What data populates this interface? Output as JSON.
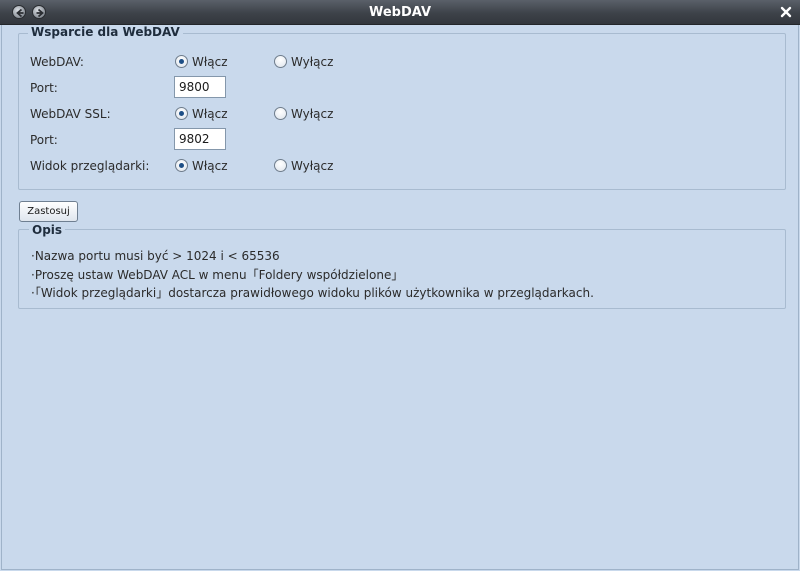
{
  "window": {
    "title": "WebDAV"
  },
  "support": {
    "legend": "Wsparcie dla WebDAV",
    "webdav_label": "WebDAV:",
    "webdav_on": "Włącz",
    "webdav_off": "Wyłącz",
    "webdav_selected": "on",
    "port_label": "Port:",
    "port_value": "9800",
    "ssl_label": "WebDAV SSL:",
    "ssl_on": "Włącz",
    "ssl_off": "Wyłącz",
    "ssl_selected": "on",
    "ssl_port_label": "Port:",
    "ssl_port_value": "9802",
    "browser_label": "Widok przeglądarki:",
    "browser_on": "Włącz",
    "browser_off": "Wyłącz",
    "browser_selected": "on"
  },
  "apply_label": "Zastosuj",
  "description": {
    "legend": "Opis",
    "lines": [
      "·Nazwa portu musi być > 1024 i < 65536",
      "·Proszę ustaw WebDAV ACL w menu「Foldery współdzielone」",
      "·「Widok przeglądarki」dostarcza prawidłowego widoku plików użytkownika w przeglądarkach."
    ]
  }
}
